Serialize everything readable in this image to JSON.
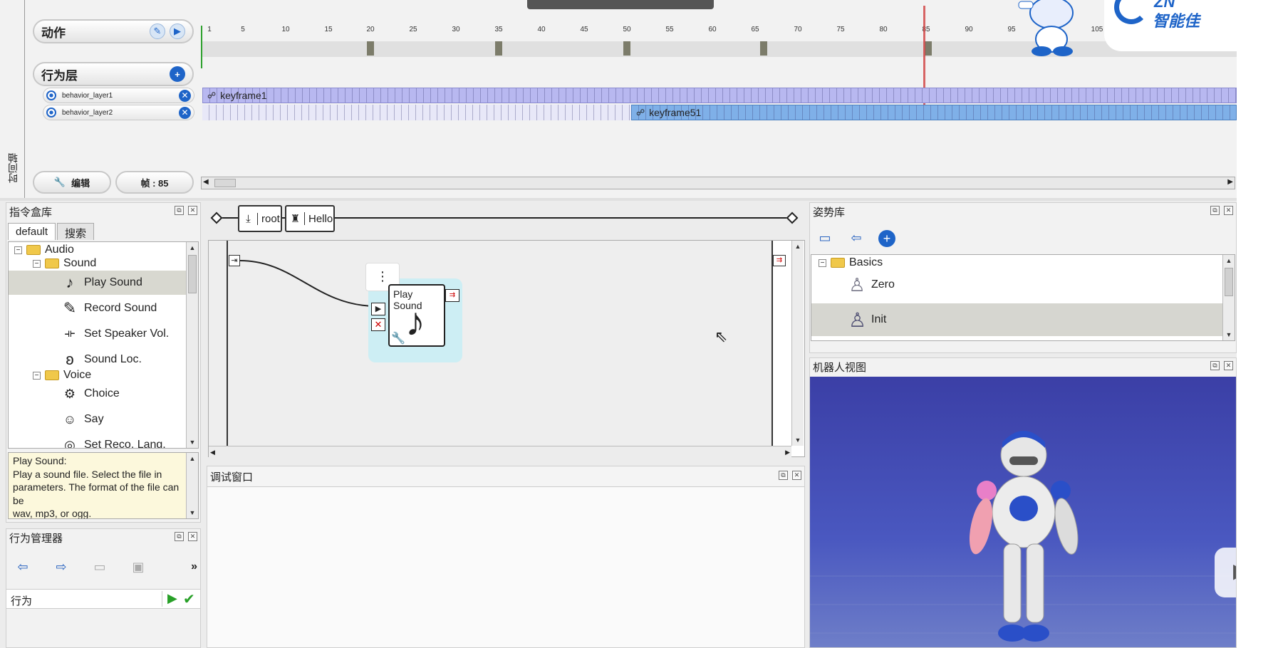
{
  "timeline": {
    "motion_label": "动作",
    "behavior_layers_label": "行为层",
    "side_label": "时间轴",
    "edit_button": "编辑",
    "frame_display": "帧 : 85",
    "ruler_ticks": [
      "1",
      "5",
      "10",
      "15",
      "20",
      "25",
      "30",
      "35",
      "40",
      "45",
      "50",
      "55",
      "60",
      "65",
      "70",
      "75",
      "80",
      "85",
      "90",
      "95",
      "105"
    ],
    "layers": [
      {
        "name": "behavior_layer1",
        "keyframe": "keyframe1"
      },
      {
        "name": "behavior_layer2",
        "keyframe": "keyframe51"
      }
    ]
  },
  "box_library": {
    "title": "指令盒库",
    "tabs": [
      "default",
      "搜索"
    ],
    "items": [
      {
        "label": "Audio",
        "type": "folder",
        "level": 0,
        "expander": "-"
      },
      {
        "label": "Sound",
        "type": "folder",
        "level": 1,
        "expander": "-"
      },
      {
        "label": "Play Sound",
        "type": "box",
        "level": 2,
        "icon": "music-note-icon",
        "selected": true
      },
      {
        "label": "Record Sound",
        "type": "box",
        "level": 2,
        "icon": "microphone-icon"
      },
      {
        "label": "Set Speaker Vol.",
        "type": "box",
        "level": 2,
        "icon": "volume-icon"
      },
      {
        "label": "Sound Loc.",
        "type": "box",
        "level": 2,
        "icon": "ear-icon"
      },
      {
        "label": "Voice",
        "type": "folder",
        "level": 1,
        "expander": "-"
      },
      {
        "label": "Choice",
        "type": "box",
        "level": 2,
        "icon": "choice-icon"
      },
      {
        "label": "Say",
        "type": "box",
        "level": 2,
        "icon": "speech-icon"
      },
      {
        "label": "Set Reco. Lang.",
        "type": "box",
        "level": 2,
        "icon": "language-icon"
      }
    ],
    "description": "Play Sound:\nPlay a sound file. Select the file in parameters. The format of the file can be\nwav, mp3, or ogg."
  },
  "behavior_manager": {
    "title": "行为管理器",
    "column_label": "行为"
  },
  "flow": {
    "breadcrumb": [
      "root",
      "Hello"
    ],
    "box_title": "Play Sound"
  },
  "debug": {
    "title": "调试窗口"
  },
  "pose_library": {
    "title": "姿势库",
    "folder": "Basics",
    "items": [
      {
        "label": "Zero",
        "selected": false
      },
      {
        "label": "Init",
        "selected": true
      }
    ]
  },
  "robot_view": {
    "title": "机器人视图"
  },
  "logo": {
    "text": "智能佳",
    "small": "ZN"
  }
}
